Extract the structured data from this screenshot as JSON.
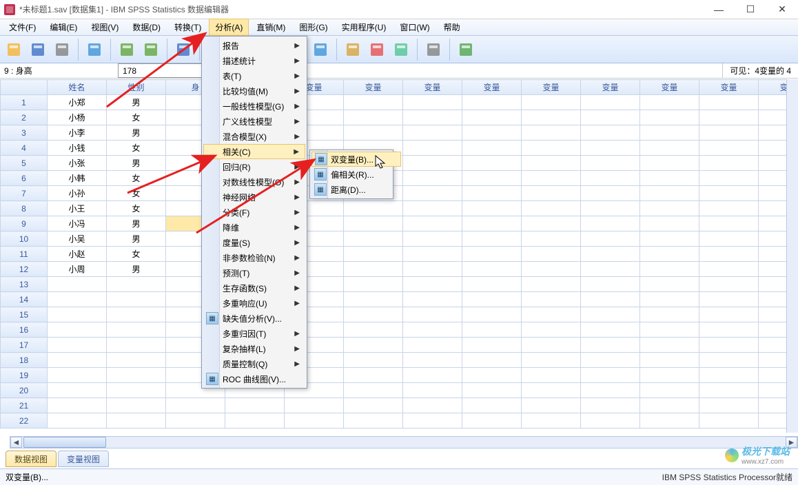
{
  "title": "*未标题1.sav [数据集1] - IBM SPSS Statistics 数据编辑器",
  "window_buttons": {
    "min": "—",
    "max": "☐",
    "close": "✕"
  },
  "menubar": [
    {
      "label": "文件(F)"
    },
    {
      "label": "编辑(E)"
    },
    {
      "label": "视图(V)"
    },
    {
      "label": "数据(D)"
    },
    {
      "label": "转换(T)"
    },
    {
      "label": "分析(A)",
      "active": true
    },
    {
      "label": "直销(M)"
    },
    {
      "label": "图形(G)"
    },
    {
      "label": "实用程序(U)"
    },
    {
      "label": "窗口(W)"
    },
    {
      "label": "帮助"
    }
  ],
  "toolbar_icons": [
    "open-icon",
    "save-icon",
    "print-icon",
    "sep",
    "recall-icon",
    "sep",
    "undo-icon",
    "redo-icon",
    "sep",
    "goto-icon",
    "sep",
    "vars-icon",
    "find-icon",
    "sep",
    "insert-case-icon",
    "insert-var-icon",
    "split-icon",
    "sep",
    "weight-icon",
    "select-icon",
    "value-labels-icon",
    "sep",
    "use-sets-icon",
    "sep",
    "spellcheck-icon"
  ],
  "cell": {
    "ref": "9 : 身高",
    "value": "178"
  },
  "visible_info": "可见：4变量的 4",
  "columns": [
    "",
    "姓名",
    "性别",
    "身",
    "变量",
    "变量",
    "变量",
    "变量",
    "变量",
    "变量",
    "变量",
    "变量",
    "变量",
    "变量"
  ],
  "rows": [
    {
      "n": "1",
      "name": "小郑",
      "sex": "男"
    },
    {
      "n": "2",
      "name": "小杨",
      "sex": "女"
    },
    {
      "n": "3",
      "name": "小李",
      "sex": "男"
    },
    {
      "n": "4",
      "name": "小钱",
      "sex": "女"
    },
    {
      "n": "5",
      "name": "小张",
      "sex": "男"
    },
    {
      "n": "6",
      "name": "小韩",
      "sex": "女"
    },
    {
      "n": "7",
      "name": "小孙",
      "sex": "女"
    },
    {
      "n": "8",
      "name": "小王",
      "sex": "女"
    },
    {
      "n": "9",
      "name": "小冯",
      "sex": "男",
      "selected": true
    },
    {
      "n": "10",
      "name": "小吴",
      "sex": "男"
    },
    {
      "n": "11",
      "name": "小赵",
      "sex": "女"
    },
    {
      "n": "12",
      "name": "小周",
      "sex": "男"
    },
    {
      "n": "13"
    },
    {
      "n": "14"
    },
    {
      "n": "15"
    },
    {
      "n": "16"
    },
    {
      "n": "17"
    },
    {
      "n": "18"
    },
    {
      "n": "19"
    },
    {
      "n": "20"
    },
    {
      "n": "21"
    },
    {
      "n": "22"
    }
  ],
  "analyze_menu": [
    {
      "label": "报告",
      "sub": true
    },
    {
      "label": "描述统计",
      "sub": true
    },
    {
      "label": "表(T)",
      "sub": true
    },
    {
      "label": "比较均值(M)",
      "sub": true
    },
    {
      "label": "一般线性模型(G)",
      "sub": true
    },
    {
      "label": "广义线性模型",
      "sub": true
    },
    {
      "label": "混合模型(X)",
      "sub": true
    },
    {
      "label": "相关(C)",
      "sub": true,
      "hover": true
    },
    {
      "label": "回归(R)",
      "sub": true
    },
    {
      "label": "对数线性模型(O)",
      "sub": true
    },
    {
      "label": "神经网络",
      "sub": true
    },
    {
      "label": "分类(F)",
      "sub": true
    },
    {
      "label": "降维",
      "sub": true
    },
    {
      "label": "度量(S)",
      "sub": true
    },
    {
      "label": "非参数检验(N)",
      "sub": true
    },
    {
      "label": "预测(T)",
      "sub": true
    },
    {
      "label": "生存函数(S)",
      "sub": true
    },
    {
      "label": "多重响应(U)",
      "sub": true
    },
    {
      "label": "缺失值分析(V)...",
      "sub": false,
      "icon": true
    },
    {
      "label": "多重归因(T)",
      "sub": true
    },
    {
      "label": "复杂抽样(L)",
      "sub": true
    },
    {
      "label": "质量控制(Q)",
      "sub": true
    },
    {
      "label": "ROC 曲线图(V)...",
      "sub": false,
      "icon": true
    }
  ],
  "correlate_submenu": [
    {
      "label": "双变量(B)...",
      "icon": true,
      "hover": true
    },
    {
      "label": "偏相关(R)...",
      "icon": true
    },
    {
      "label": "距离(D)...",
      "icon": true
    }
  ],
  "bottom_tabs": {
    "data": "数据视图",
    "var": "变量视图"
  },
  "status": {
    "left": "双变量(B)...",
    "right": "IBM SPSS Statistics Processor就绪"
  },
  "watermark": {
    "brand": "极光下载站",
    "url": "www.xz7.com"
  }
}
